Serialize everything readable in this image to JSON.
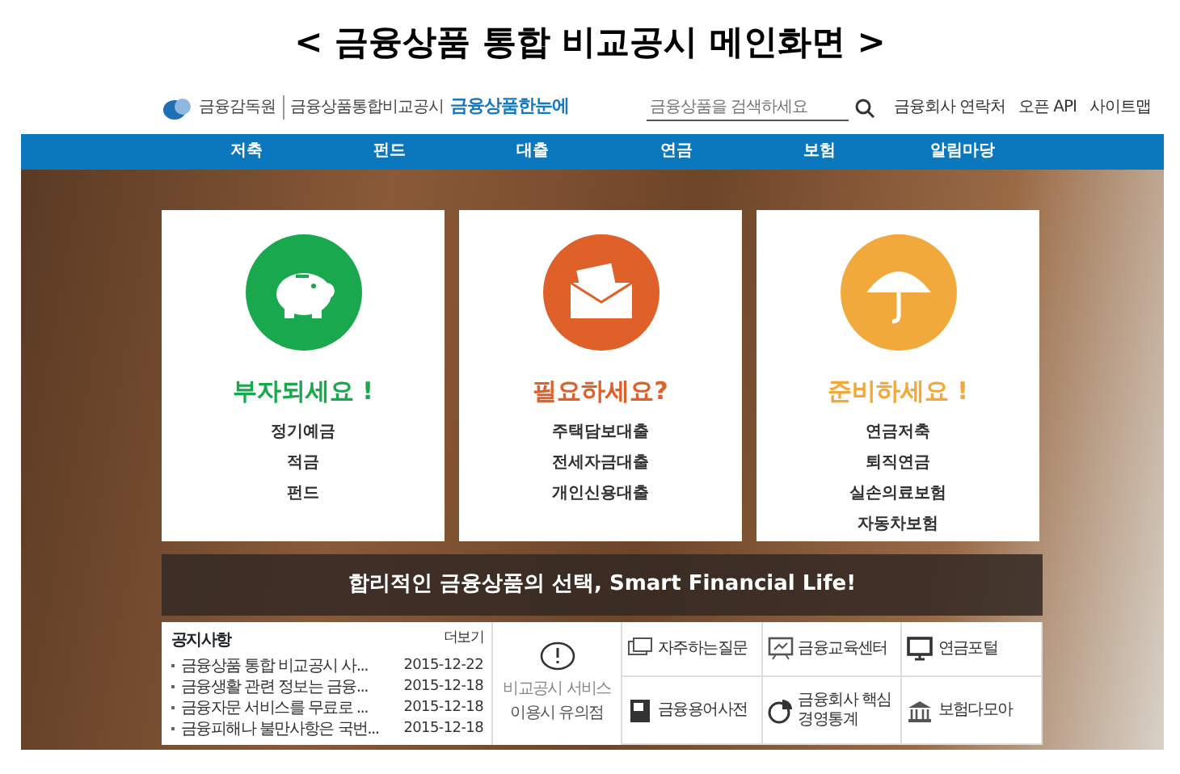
{
  "page_title": "< 금융상품 통합 비교공시 메인화면 >",
  "header": {
    "logo_org": "금융감독원",
    "logo_site": "금융상품통합비교공시",
    "logo_brand": "금융상품한눈에",
    "search": {
      "placeholder": "금융상품을 검색하세요"
    },
    "links": [
      "금융회사 연락처",
      "오픈 API",
      "사이트맵"
    ]
  },
  "nav": [
    "저축",
    "펀드",
    "대출",
    "연금",
    "보험",
    "알림마당"
  ],
  "cards": [
    {
      "kind": "piggy",
      "color": "#1aa84f",
      "heading": "부자되세요 !",
      "items": [
        "정기예금",
        "적금",
        "펀드"
      ]
    },
    {
      "kind": "envelope",
      "color": "#e0602a",
      "heading": "필요하세요?",
      "items": [
        "주택담보대출",
        "전세자금대출",
        "개인신용대출"
      ]
    },
    {
      "kind": "umbrella",
      "color": "#f2a93b",
      "heading": "준비하세요 !",
      "items": [
        "연금저축",
        "퇴직연금",
        "실손의료보험",
        "자동차보험"
      ]
    }
  ],
  "banner": "합리적인 금융상품의 선택, Smart Financial Life!",
  "notices": {
    "title": "공지사항",
    "more": "더보기",
    "items": [
      {
        "title": "금융상품 통합 비교공시 사...",
        "date": "2015-12-22"
      },
      {
        "title": "금융생활 관련 정보는 금융...",
        "date": "2015-12-18"
      },
      {
        "title": "금융자문 서비스를 무료로 ...",
        "date": "2015-12-18"
      },
      {
        "title": "금융피해나 불만사항은 국번...",
        "date": "2015-12-18"
      }
    ]
  },
  "caution": {
    "line_1": "비교공시 서비스",
    "line_2": "이용시 유의점"
  },
  "quick_links": [
    {
      "kind": "faq",
      "label": "자주하는질문"
    },
    {
      "kind": "education",
      "label": "금융교육센터"
    },
    {
      "kind": "pension",
      "label": "연금포털"
    },
    {
      "kind": "dictionary",
      "label": "금융용어사전"
    },
    {
      "kind": "stats",
      "label": "금융회사 핵심경영통계"
    },
    {
      "kind": "insurance",
      "label": "보험다모아"
    }
  ]
}
